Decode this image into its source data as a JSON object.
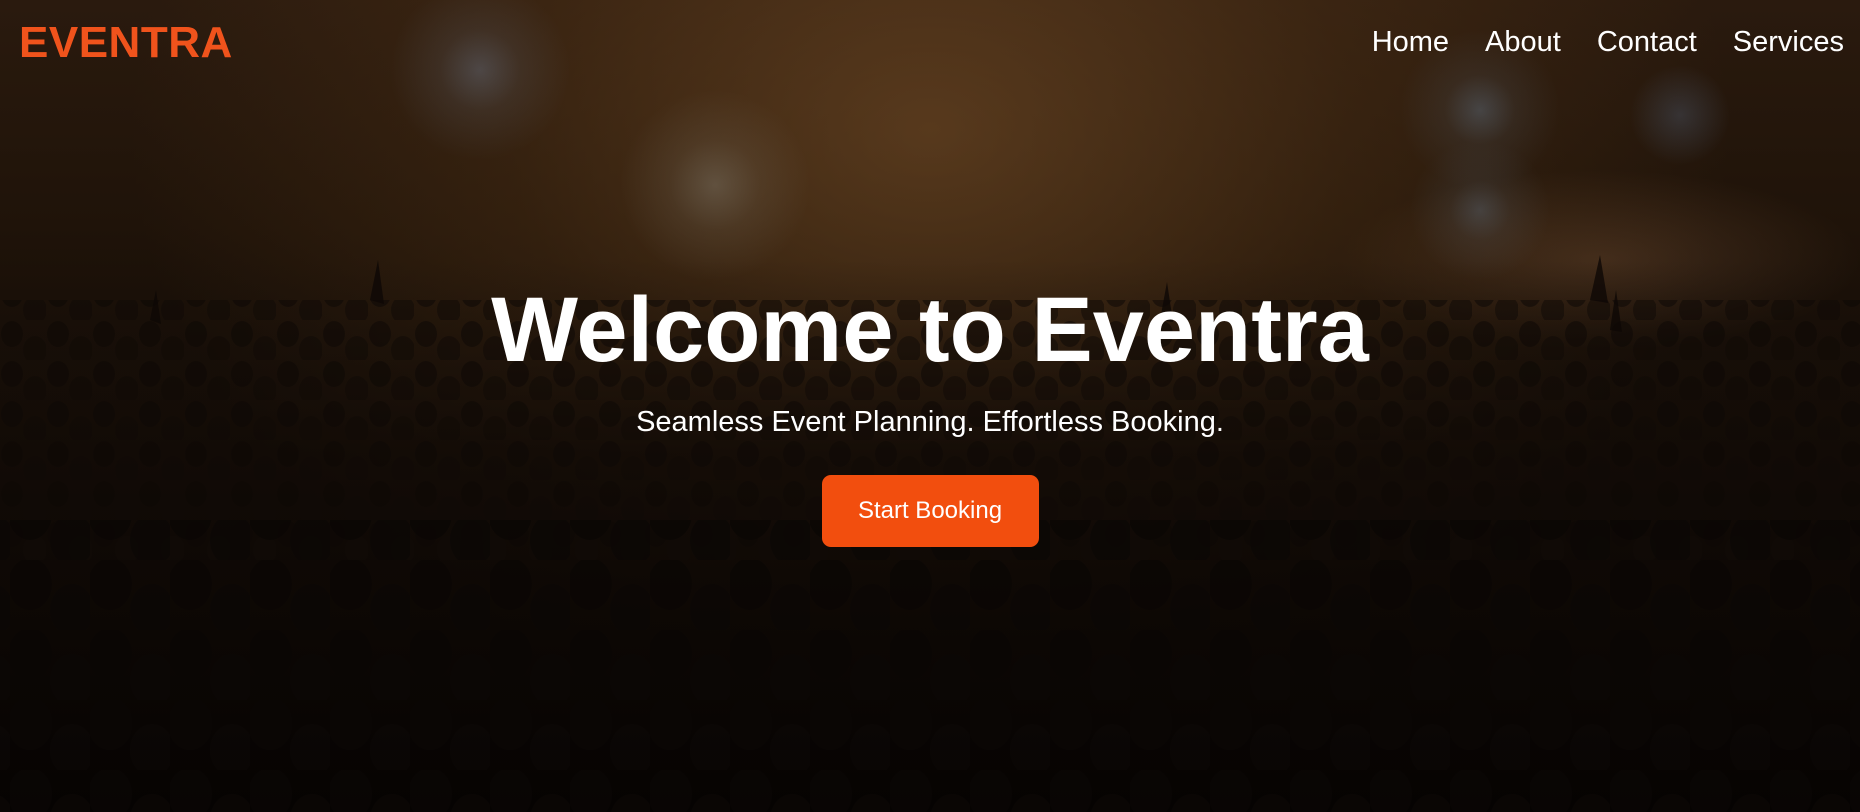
{
  "brand": {
    "logo_text": "EVENTRA",
    "accent_color": "#f0531c"
  },
  "nav": {
    "items": [
      {
        "label": "Home"
      },
      {
        "label": "About"
      },
      {
        "label": "Contact"
      },
      {
        "label": "Services"
      }
    ]
  },
  "hero": {
    "title": "Welcome to Eventra",
    "subtitle": "Seamless Event Planning. Effortless Booking.",
    "cta_label": "Start Booking",
    "cta_color": "#f24e0e",
    "background": "concert-crowd-photo"
  }
}
